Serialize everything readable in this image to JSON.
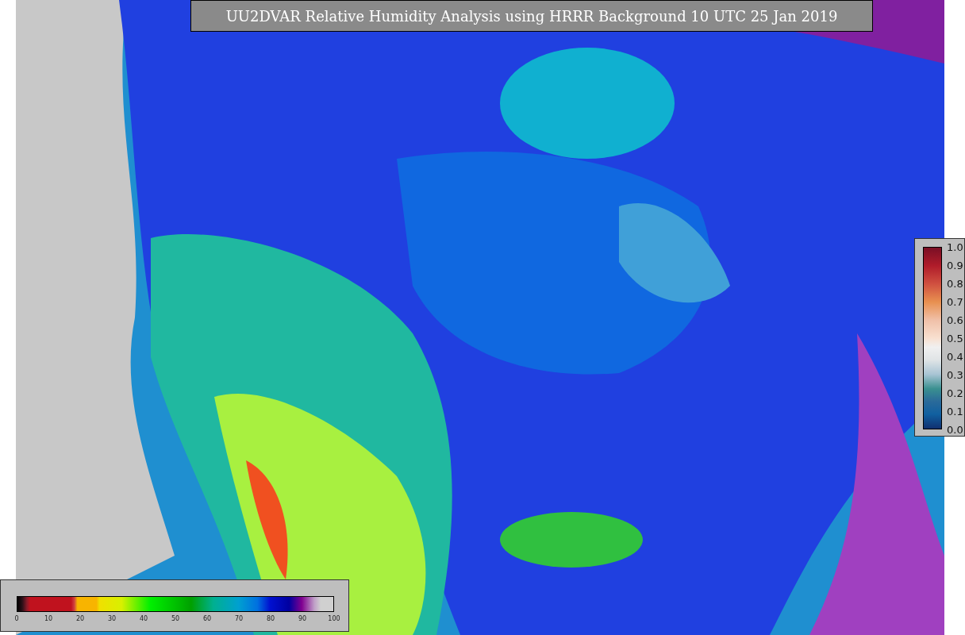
{
  "title": "UU2DVAR Relative Humidity Analysis using HRRR Background 10 UTC 25 Jan 2019",
  "colorbar_horizontal": {
    "ticks": [
      "0",
      "10",
      "20",
      "30",
      "40",
      "50",
      "60",
      "70",
      "80",
      "90",
      "100"
    ]
  },
  "colorbar_vertical": {
    "ticks": [
      "1.0",
      "0.9",
      "0.8",
      "0.7",
      "0.6",
      "0.5",
      "0.4",
      "0.3",
      "0.2",
      "0.1",
      "0.0"
    ]
  }
}
